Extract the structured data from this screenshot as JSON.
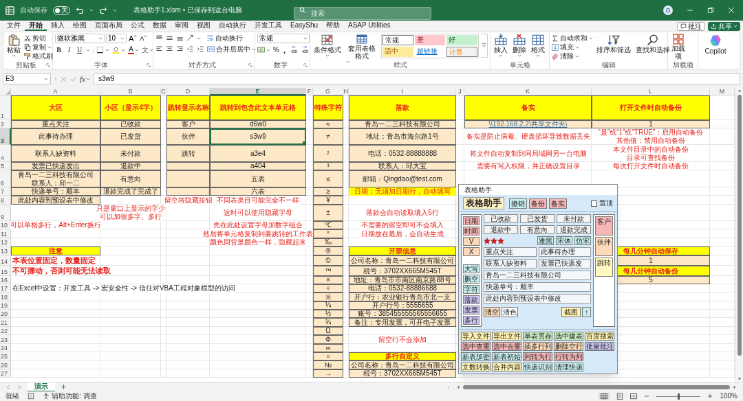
{
  "title_bar": {
    "autosave_label": "自动保存",
    "autosave": {
      "on": false,
      "label": "关"
    },
    "document_title": "表格助手1.xlsm • 已保存到这台电脑",
    "search_placeholder": "搜索",
    "avatar": "G"
  },
  "menu_tabs": [
    {
      "label": "文件",
      "selected": false
    },
    {
      "label": "开始",
      "selected": true
    },
    {
      "label": "插入",
      "selected": false
    },
    {
      "label": "绘图",
      "selected": false
    },
    {
      "label": "页面布局",
      "selected": false
    },
    {
      "label": "公式",
      "selected": false
    },
    {
      "label": "数据",
      "selected": false
    },
    {
      "label": "审阅",
      "selected": false
    },
    {
      "label": "视图",
      "selected": false
    },
    {
      "label": "自动执行",
      "selected": false
    },
    {
      "label": "开发工具",
      "selected": false
    },
    {
      "label": "EasyShu",
      "selected": false
    },
    {
      "label": "帮助",
      "selected": false
    },
    {
      "label": "ASAP Utilities",
      "selected": false
    }
  ],
  "comments_button": "批注",
  "share_button": "共享",
  "ribbon": {
    "clipboard": {
      "paste": "粘贴",
      "cut": "剪切",
      "copy": "复制",
      "format_painter": "格式刷",
      "label": "剪贴板"
    },
    "font": {
      "font_name": "微软雅黑",
      "font_size": "10",
      "grow": "A",
      "shrink": "A",
      "styles": [
        "B",
        "I",
        "U"
      ],
      "font_color": "A",
      "phonetic": "文",
      "label": "字体"
    },
    "alignment": {
      "wrap_text": "自动换行",
      "merge": "合并后居中",
      "label": "对齐方式"
    },
    "number": {
      "format": "常规",
      "percent": "%",
      "comma": ",",
      "label": "数字"
    },
    "styles": {
      "conditional": "条件格式",
      "table_format": "套用表格格式",
      "gallery": [
        {
          "label": "常规",
          "kind": "normal"
        },
        {
          "label": "差",
          "kind": "bad"
        },
        {
          "label": "好",
          "kind": "good"
        },
        {
          "label": "适中",
          "kind": "neutral"
        },
        {
          "label": "超链接",
          "kind": "link"
        },
        {
          "label": "计算",
          "kind": "calc"
        }
      ],
      "label": "样式"
    },
    "cells": {
      "buttons": [
        "插入",
        "删除",
        "格式"
      ],
      "label": "单元格"
    },
    "editing": {
      "autosum": "自动求和",
      "fill": "填充",
      "clear": "清除",
      "sort": "排序和筛选",
      "find": "查找和选择",
      "label": "编辑"
    },
    "addins": {
      "button": "加载项",
      "label": "加载项"
    },
    "copilot": "Copilot"
  },
  "formula_bar": {
    "name_box": "E3",
    "fx": "fx",
    "formula": "s3w9"
  },
  "columns": [
    "A",
    "B",
    "C",
    "D",
    "E",
    "F",
    "G",
    "H",
    "I",
    "J",
    "K",
    "L",
    "M"
  ],
  "rows": [
    {
      "number": "1",
      "cells": {
        "A": {
          "text": "大区",
          "kind": "header",
          "selected": false
        },
        "B": {
          "text": "小区（显示4字）",
          "kind": "header",
          "selected": false
        },
        "D": {
          "text": "跳转显示名称",
          "kind": "header",
          "selected": false
        },
        "E": {
          "text": "跳转到包含此文本单元格",
          "kind": "header",
          "selected": false
        },
        "G": {
          "text": "特殊字符",
          "kind": "header",
          "selected": false
        },
        "I": {
          "text": "落款",
          "kind": "header",
          "selected": false
        },
        "K": {
          "text": "备实",
          "kind": "header",
          "selected": false
        },
        "L": {
          "text": "打开文件时自动备份",
          "kind": "header",
          "selected": false
        }
      }
    },
    {
      "number": "2",
      "cells": {
        "A": {
          "text": "重点关注",
          "kind": "data",
          "selected": false
        },
        "B": {
          "text": "已收款",
          "kind": "data",
          "selected": false
        },
        "D": {
          "text": "客户",
          "kind": "data",
          "selected": false
        },
        "E": {
          "text": "d6w0",
          "kind": "data",
          "selected": false
        },
        "G": {
          "text": "≈",
          "kind": "data",
          "selected": false
        },
        "I": {
          "text": "青岛一二三科技有限公司",
          "kind": "data",
          "selected": false
        },
        "K": {
          "text": "\\\\192.168.2.2\\共享文件夹\\",
          "kind": "link",
          "selected": false
        },
        "L": {
          "text": "1",
          "kind": "data",
          "selected": false
        }
      }
    },
    {
      "number": "3",
      "cells": {
        "A": {
          "text": "此事待办理",
          "kind": "data",
          "selected": false
        },
        "B": {
          "text": "已发货",
          "kind": "data",
          "selected": false
        },
        "D": {
          "text": "伙伴",
          "kind": "data",
          "selected": false
        },
        "E": {
          "text": "s3w9",
          "kind": "data",
          "selected": true
        },
        "G": {
          "text": "≠",
          "kind": "data",
          "selected": false
        },
        "I": {
          "text": "地址：青岛市海尔路1号",
          "kind": "data",
          "selected": false
        },
        "K": {
          "text": "备实是防止病毒、硬盘损坏导致数据丢失",
          "kind": "note",
          "selected": false
        },
        "L": {
          "lines": [
            "“是”或“1”或“TRUE”：启用自动备份",
            "其他值：禁用自动备份"
          ],
          "kind": "note",
          "selected": false
        }
      }
    },
    {
      "number": "4",
      "cells": {
        "A": {
          "text": "联系人缺资料",
          "kind": "data",
          "selected": false
        },
        "B": {
          "text": "未付款",
          "kind": "data",
          "selected": false
        },
        "D": {
          "text": "跳转",
          "kind": "data",
          "selected": false
        },
        "E": {
          "text": "a3e4",
          "kind": "data",
          "selected": false
        },
        "G": {
          "text": "²",
          "kind": "data",
          "selected": false
        },
        "I": {
          "text": "电话：0532-88888888",
          "kind": "data",
          "selected": false
        },
        "K": {
          "text": "将文件自动复制到同局域网另一台电脑",
          "kind": "note",
          "selected": false
        },
        "L": {
          "lines": [
            "本文件目录中的自动备份",
            "目录可查找备份"
          ],
          "kind": "note",
          "selected": false
        }
      }
    },
    {
      "number": "5",
      "cells": {
        "A": {
          "text": "发票已快递发出",
          "kind": "data",
          "selected": false
        },
        "B": {
          "text": "退款中",
          "kind": "data",
          "selected": false
        },
        "D": {
          "kind": "data",
          "selected": false
        },
        "E": {
          "text": "a404",
          "kind": "data",
          "selected": false
        },
        "G": {
          "text": "³",
          "kind": "data",
          "selected": false
        },
        "I": {
          "text": "联系人：邱大宝",
          "kind": "data",
          "selected": false
        },
        "K": {
          "text": "需要有写入权限，并正确设置目录",
          "kind": "note",
          "selected": false
        },
        "L": {
          "text": "每次打开文件时自动备份",
          "kind": "note",
          "selected": false
        }
      }
    },
    {
      "number": "6",
      "cells": {
        "A": {
          "lines": [
            "青岛一二三科技有限公司",
            "联系人：邱一二"
          ],
          "kind": "data",
          "selected": false
        },
        "B": {
          "text": "有意向",
          "kind": "data",
          "selected": false
        },
        "D": {
          "kind": "data",
          "selected": false
        },
        "E": {
          "text": "五表",
          "kind": "data",
          "selected": false
        },
        "G": {
          "text": "≤",
          "kind": "data",
          "selected": false
        },
        "I": {
          "text": "邮箱：Qingdao@test.com",
          "kind": "data",
          "selected": false
        }
      }
    },
    {
      "number": "7",
      "cells": {
        "A": {
          "text": "快递单号：顺丰",
          "kind": "data",
          "selected": false
        },
        "B": {
          "text": "退款完成了完成了",
          "kind": "data",
          "selected": false
        },
        "D": {
          "kind": "data",
          "selected": false
        },
        "E": {
          "text": "六表",
          "kind": "data",
          "selected": false
        },
        "G": {
          "text": "≥",
          "kind": "data",
          "selected": false
        },
        "I": {
          "text": "日期：无须加日期行，自动填写",
          "kind": "highlight",
          "selected": false
        }
      }
    },
    {
      "number": "8",
      "cells": {
        "A": {
          "text": "此处内容到预设表中修改",
          "kind": "data",
          "selected": false
        },
        "D": {
          "text": "留空将隐藏按钮",
          "kind": "note",
          "selected": false
        },
        "E": {
          "text": "不同表类目可能完全不一样",
          "kind": "note",
          "selected": false
        },
        "G": {
          "text": "¥",
          "kind": "data",
          "selected": false
        }
      }
    },
    {
      "number": "9",
      "cells": {
        "B": {
          "lines": [
            "只是窗口上显示的字少",
            "可以加很多字、多行"
          ],
          "kind": "note",
          "selected": false
        },
        "E": {
          "text": "这时可以使用隐藏字母",
          "kind": "note",
          "selected": false
        },
        "G": {
          "text": "±",
          "kind": "data",
          "selected": false
        },
        "I": {
          "text": "落款会自动读取填入5行",
          "kind": "note",
          "selected": false
        }
      }
    },
    {
      "number": "10",
      "cells": {
        "A": {
          "text": "可以单格多行，Alt+Enter换行",
          "kind": "note",
          "selected": false
        },
        "E": {
          "text": "先在此处设置字母加数字组合",
          "kind": "note",
          "selected": false
        },
        "G": {
          "text": "℃",
          "kind": "data",
          "selected": false
        },
        "I": {
          "text": "不需要的留空即可不会填入",
          "kind": "note",
          "selected": false
        }
      }
    },
    {
      "number": "11",
      "cells": {
        "E": {
          "text": "然后将单元格复制到要跳转的工作表",
          "kind": "note",
          "selected": false
        },
        "G": {
          "text": "°",
          "kind": "data",
          "selected": false
        },
        "I": {
          "text": "日期放在最后，会自动生成",
          "kind": "note",
          "selected": false
        }
      }
    },
    {
      "number": "12",
      "cells": {
        "E": {
          "text": "颜色同背景颜色一样，隐藏起来",
          "kind": "note",
          "selected": false
        },
        "G": {
          "text": "‰",
          "kind": "data",
          "selected": false
        }
      }
    },
    {
      "number": "13",
      "cells": {
        "A": {
          "text": "注意",
          "kind": "header",
          "selected": false
        },
        "G": {
          "text": "®",
          "kind": "data",
          "selected": false
        },
        "I": {
          "text": "开票信息",
          "kind": "header",
          "selected": false
        },
        "L": {
          "text": "每几分钟自动保存",
          "kind": "header",
          "selected": false
        }
      }
    },
    {
      "number": "14",
      "cells": {
        "A": {
          "text": "本表位置固定，数量固定",
          "kind": "warning",
          "selected": false
        },
        "G": {
          "text": "©",
          "kind": "data",
          "selected": false
        },
        "I": {
          "text": "公司名称：青岛一二科技有限公司",
          "kind": "data",
          "selected": false
        },
        "L": {
          "text": "1",
          "kind": "data",
          "selected": false
        }
      }
    },
    {
      "number": "15",
      "cells": {
        "A": {
          "text": "不可挪动，否则可能无法读取",
          "kind": "warning",
          "selected": false
        },
        "G": {
          "text": "™",
          "kind": "data",
          "selected": false
        },
        "I": {
          "text": "税号：3702XX665M545T",
          "kind": "data",
          "selected": false
        },
        "L": {
          "text": "每几分钟自动备份",
          "kind": "header",
          "selected": false
        }
      }
    },
    {
      "number": "16",
      "cells": {
        "G": {
          "text": "×",
          "kind": "data",
          "selected": false
        },
        "I": {
          "text": "地址：青岛市市南区南京路88号",
          "kind": "data",
          "selected": false
        },
        "L": {
          "text": "5",
          "kind": "data",
          "selected": false
        }
      }
    },
    {
      "number": "17",
      "cells": {
        "A": {
          "text": "在Excel中设置：开发工具 -> 宏安全性 -> 信任对VBA工程对象模型的访问",
          "kind": "plain",
          "selected": false
        },
        "G": {
          "text": "÷",
          "kind": "data",
          "selected": false
        },
        "I": {
          "text": "电话：0532-88886688",
          "kind": "data",
          "selected": false
        }
      }
    },
    {
      "number": "18",
      "cells": {
        "G": {
          "text": "※",
          "kind": "data",
          "selected": false
        },
        "I": {
          "text": "开户行：农业银行青岛市北一支",
          "kind": "data",
          "selected": false
        }
      }
    },
    {
      "number": "19",
      "cells": {
        "G": {
          "text": "¼",
          "kind": "data",
          "selected": false
        },
        "I": {
          "text": "开户行号：5555655",
          "kind": "data",
          "selected": false
        }
      }
    },
    {
      "number": "20",
      "cells": {
        "G": {
          "text": "½",
          "kind": "data",
          "selected": false
        },
        "I": {
          "text": "账号：385455555565556655",
          "kind": "data",
          "selected": false
        }
      }
    },
    {
      "number": "21",
      "cells": {
        "G": {
          "text": "¾",
          "kind": "data",
          "selected": false
        },
        "I": {
          "text": "备注：专用发票，可开电子发票",
          "kind": "data",
          "selected": false
        }
      }
    },
    {
      "number": "22",
      "cells": {
        "G": {
          "text": "Ω",
          "kind": "data",
          "selected": false
        }
      }
    },
    {
      "number": "23",
      "cells": {
        "G": {
          "text": "Φ",
          "kind": "data",
          "selected": false
        },
        "I": {
          "text": "留空行不会添加",
          "kind": "note",
          "selected": false
        }
      }
    },
    {
      "number": "24",
      "cells": {
        "G": {
          "text": "∞",
          "kind": "data",
          "selected": false
        }
      }
    },
    {
      "number": "25",
      "cells": {
        "G": {
          "text": "○",
          "kind": "data",
          "selected": false
        },
        "I": {
          "text": "多行自定义",
          "kind": "header",
          "selected": false
        }
      }
    },
    {
      "number": "26",
      "cells": {
        "G": {
          "text": "№",
          "kind": "data",
          "selected": false
        },
        "I": {
          "text": "公司名称：青岛一二科技有限公司",
          "kind": "data",
          "selected": false
        }
      }
    },
    {
      "number": "27",
      "cells": {
        "G": {
          "text": "→",
          "kind": "data",
          "selected": false
        },
        "I": {
          "text": "税号：3702XX665M545T",
          "kind": "data",
          "selected": false
        }
      }
    }
  ],
  "helper_dialog": {
    "title": "表格助手",
    "brand_button": "表格助手",
    "top_buttons": [
      {
        "label": "撤销",
        "color": "#c8eeee"
      },
      {
        "label": "备份",
        "color": "#f4b6b6"
      },
      {
        "label": "备实",
        "color": "#f4b6b6"
      }
    ],
    "pin": {
      "label": "置顶",
      "checked": false
    },
    "mark_buttons": [
      {
        "label": "日期",
        "color": "#f4b6b6"
      },
      {
        "label": "时间",
        "color": "#f4b6b6"
      },
      {
        "label": "V",
        "color": "#fbd9b9"
      },
      {
        "label": "X",
        "color": "#fbd9b9"
      }
    ],
    "tool_buttons": [
      {
        "label": "大写",
        "color": "#c8eeee"
      },
      {
        "label": "删空",
        "color": "#c8eeee"
      },
      {
        "label": "字符",
        "color": "#c8eeee"
      },
      {
        "label": "落款",
        "color": "#cbc6f2"
      },
      {
        "label": "发票",
        "color": "#cbc6f2"
      },
      {
        "label": "多行",
        "color": "#cbc6f2"
      }
    ],
    "status_buttons": [
      "已收款",
      "已发货",
      "未付款",
      "退款中",
      "有意向",
      "退款完成"
    ],
    "stars": 3,
    "font_buttons": [
      {
        "label": "雅黑",
        "color": "#c8eeee"
      },
      {
        "label": "宋体",
        "color": "#c8eeee"
      },
      {
        "label": "仿宋",
        "color": "#c8eeee"
      }
    ],
    "short_fields": [
      "重点关注",
      "此事待办理",
      "联系人缺资料",
      "发票已快递发"
    ],
    "long_fields": [
      "青岛一二三科技有限公司",
      "快递单号：顺丰",
      "此处内容到预设表中修改"
    ],
    "clear_buttons": [
      {
        "label": "清空",
        "color": "#fbd9b9"
      },
      {
        "label": "清色",
        "color": "#ffffff"
      }
    ],
    "capture_buttons": [
      {
        "label": "截图",
        "color": "#fff2b0"
      },
      {
        "label": "↑",
        "color": "#c8eeee"
      }
    ],
    "jump_buttons": [
      {
        "label": "客户",
        "color": "#f4b6b6"
      },
      {
        "label": "伙伴",
        "color": "#fbd9b9"
      },
      {
        "label": "跳转",
        "color": "#fff6c0"
      }
    ],
    "action_rows": [
      [
        {
          "label": "导入文件",
          "color": "#fff2b0"
        },
        {
          "label": "导出文件",
          "color": "#fff2b0"
        },
        {
          "label": "单表另存",
          "color": "#c8ecc0"
        },
        {
          "label": "选中建表",
          "color": "#c8ecc0"
        },
        {
          "label": "百度搜索",
          "color": "#fff2b0"
        }
      ],
      [
        {
          "label": "选中查重",
          "color": "#f4b6b6"
        },
        {
          "label": "选中去重",
          "color": "#f4b6b6"
        },
        {
          "label": "插多行列",
          "color": "#fbd9b9"
        },
        {
          "label": "删除空行",
          "color": "#fbd9b9"
        },
        {
          "label": "批量批注",
          "color": "#cbc6f2"
        }
      ],
      [
        {
          "label": "新表加密",
          "color": "#c8eeee"
        },
        {
          "label": "新表初始",
          "color": "#c8eeee"
        },
        {
          "label": "列转为行",
          "color": "#f4b6b6"
        },
        {
          "label": "行转为列",
          "color": "#f4b6b6"
        }
      ],
      [
        {
          "label": "文数转换",
          "color": "#fff2b0"
        },
        {
          "label": "合并内容",
          "color": "#fff2b0"
        },
        {
          "label": "快递识别",
          "color": "#c8eeee"
        },
        {
          "label": "清理快递",
          "color": "#c8eeee"
        }
      ]
    ]
  },
  "sheet_tabs": [
    {
      "label": "演示",
      "selected": true
    }
  ],
  "status_bar": {
    "ready": "就绪",
    "accessibility": "辅助功能: 调查",
    "zoom": {
      "level": 0.5,
      "reading": "100%"
    }
  }
}
